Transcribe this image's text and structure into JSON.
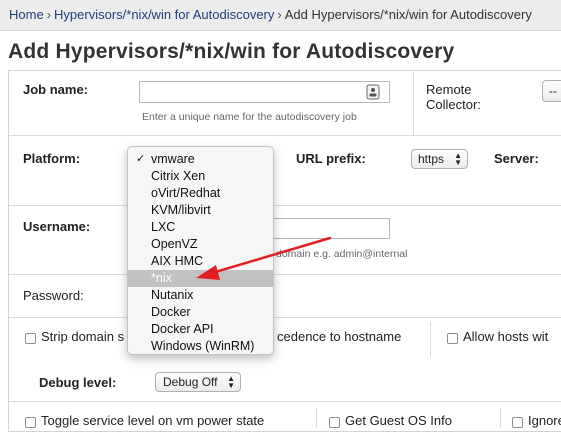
{
  "breadcrumb": {
    "items": [
      "Home",
      "Hypervisors/*nix/win for Autodiscovery",
      "Add Hypervisors/*nix/win for Autodiscovery"
    ],
    "separator": "›"
  },
  "page": {
    "title": "Add Hypervisors/*nix/win for Autodiscovery"
  },
  "form": {
    "job_name_label": "Job name:",
    "job_name_value": "",
    "job_name_hint": "Enter a unique name for the autodiscovery job",
    "remote_collector_label": "Remote\nCollector:",
    "remote_collector_value": "--",
    "platform_label": "Platform:",
    "url_prefix_label": "URL prefix:",
    "url_prefix_value": "https",
    "server_label": "Server:",
    "username_label": "Username:",
    "username_hint_partial": "domain e.g. admin@internal",
    "password_label": "Password:",
    "strip_domain_label": "Strip domain s",
    "precedence_label": "cedence to hostname",
    "allow_hosts_label": "Allow hosts wit",
    "debug_level_label": "Debug level:",
    "debug_level_value": "Debug Off",
    "toggle_service_label": "Toggle service level on vm power state",
    "get_guest_os_label": "Get Guest OS Info",
    "ignore_label": "Ignore"
  },
  "platform_dropdown": {
    "options": [
      "vmware",
      "Citrix Xen",
      "oVirt/Redhat",
      "KVM/libvirt",
      "LXC",
      "OpenVZ",
      "AIX HMC",
      "*nix",
      "Nutanix",
      "Docker",
      "Docker API",
      "Windows (WinRM)"
    ],
    "selected": "vmware",
    "highlighted": "*nix"
  },
  "colors": {
    "link": "#1f3f7a",
    "annotation_arrow": "#e02020",
    "highlight": "#c2c2c2"
  },
  "icons": {
    "input_icon": "contact-card-icon",
    "updown_icon": "updown-arrows-icon",
    "check_icon": "checkmark-icon"
  }
}
